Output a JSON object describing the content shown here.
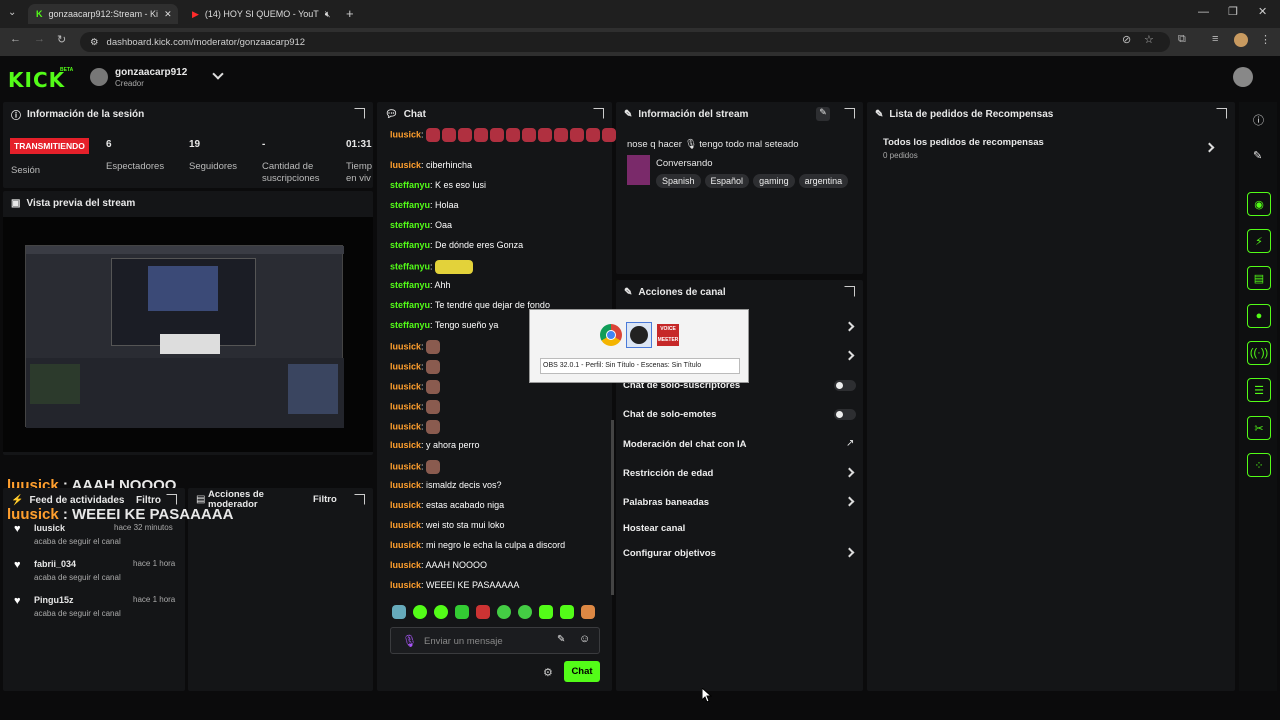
{
  "browser": {
    "tabs": [
      {
        "title": "gonzaacarp912:Stream - Ki"
      },
      {
        "title": "(14) HOY SI QUEMO - YouT"
      }
    ],
    "url": "dashboard.kick.com/moderator/gonzaacarp912"
  },
  "header": {
    "logo": "KICK",
    "beta": "BETA",
    "username": "gonzaacarp912",
    "role": "Creador"
  },
  "session": {
    "title": "Información de la sesión",
    "status": "TRANSMITIENDO",
    "status_label": "Sesión",
    "stats": [
      {
        "value": "6",
        "label": "Espectadores"
      },
      {
        "value": "19",
        "label": "Seguidores"
      },
      {
        "value": "-",
        "label": "Cantidad de suscripciones"
      },
      {
        "value": "01:31",
        "label": "Tiemp en viv"
      }
    ]
  },
  "preview": {
    "title": "Vista previa del stream"
  },
  "overlay": {
    "line1_user": "luusick",
    "line1_msg": ": AAAH NOOOO",
    "line2_user": "luusick",
    "line2_msg": ": WEEEI KE PASAAAAA"
  },
  "activity": {
    "title": "Feed de actividades",
    "filter": "Filtro",
    "items": [
      {
        "user": "luusick",
        "time": "hace 32 minutos",
        "action": "acaba de seguir el canal"
      },
      {
        "user": "fabrii_034",
        "time": "hace 1 hora",
        "action": "acaba de seguir el canal"
      },
      {
        "user": "Pingu15z",
        "time": "hace 1 hora",
        "action": "acaba de seguir el canal"
      }
    ]
  },
  "modactions": {
    "title_line1": "Acciones de",
    "title_line2": "moderador",
    "filter": "Filtro"
  },
  "chat": {
    "title": "Chat",
    "messages": [
      {
        "user": "luusick",
        "text": "",
        "kind": "emotes"
      },
      {
        "user": "luusick",
        "text": "ciberhincha"
      },
      {
        "user": "steffanyu",
        "text": "K es eso lusi"
      },
      {
        "user": "steffanyu",
        "text": "Holaa"
      },
      {
        "user": "steffanyu",
        "text": "Oaa"
      },
      {
        "user": "steffanyu",
        "text": "De dónde eres Gonza"
      },
      {
        "user": "steffanyu",
        "text": "",
        "kind": "emote"
      },
      {
        "user": "steffanyu",
        "text": "Ahh"
      },
      {
        "user": "steffanyu",
        "text": "Te tendré que dejar de fondo"
      },
      {
        "user": "steffanyu",
        "text": "Tengo sueño ya"
      },
      {
        "user": "luusick",
        "text": "",
        "kind": "emote"
      },
      {
        "user": "luusick",
        "text": "",
        "kind": "emote"
      },
      {
        "user": "luusick",
        "text": "",
        "kind": "emote"
      },
      {
        "user": "luusick",
        "text": "",
        "kind": "emote"
      },
      {
        "user": "luusick",
        "text": "",
        "kind": "emote"
      },
      {
        "user": "luusick",
        "text": "y ahora perro"
      },
      {
        "user": "luusick",
        "text": "",
        "kind": "emote"
      },
      {
        "user": "luusick",
        "text": "ismaldz decis vos?"
      },
      {
        "user": "luusick",
        "text": "estas acabado niga"
      },
      {
        "user": "luusick",
        "text": "wei sto sta mui loko"
      },
      {
        "user": "luusick",
        "text": "mi negro le echa la culpa a discord"
      },
      {
        "user": "luusick",
        "text": "AAAH NOOOO"
      },
      {
        "user": "luusick",
        "text": "WEEEI KE PASAAAAA"
      }
    ],
    "input_placeholder": "Enviar un mensaje",
    "send_label": "Chat"
  },
  "streaminfo": {
    "title": "Información del stream",
    "stream_title": "nose q hacer 🎙 tengo todo mal seteado",
    "category": "Conversando",
    "tags": [
      "Spanish",
      "Español",
      "gaming",
      "argentina"
    ]
  },
  "channel": {
    "title": "Acciones de canal",
    "rows": [
      {
        "label": "Chat de solo-suscriptores",
        "kind": "toggle"
      },
      {
        "label": "Chat de solo-emotes",
        "kind": "toggle"
      },
      {
        "label": "Moderación del chat con IA",
        "kind": "external"
      },
      {
        "label": "Restricción de edad",
        "kind": "chevron"
      },
      {
        "label": "Palabras baneadas",
        "kind": "chevron"
      },
      {
        "label": "Hostear canal",
        "kind": "none"
      },
      {
        "label": "Configurar objetivos",
        "kind": "chevron"
      }
    ]
  },
  "rewards": {
    "title": "Lista de pedidos de Recompensas",
    "item_title": "Todos los pedidos de recompensas",
    "item_count": "0 pedidos"
  },
  "taskbar_popup": {
    "caption": "OBS 32.0.1 - Perfil: Sin Título - Escenas: Sin Título",
    "app3": "VOICE MEETER"
  },
  "colors": {
    "accent": "#53fc18",
    "live": "#e5202a",
    "username_orange": "#ff9f2e"
  }
}
